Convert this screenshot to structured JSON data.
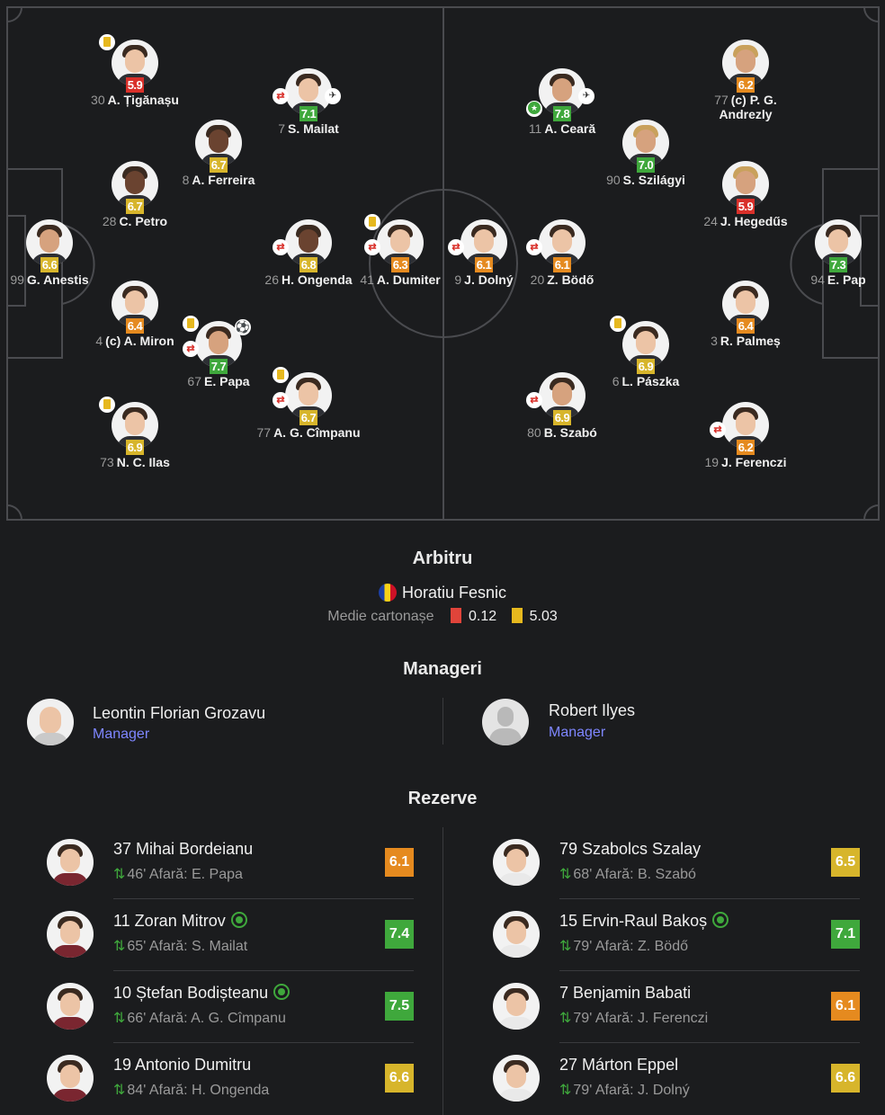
{
  "colors": {
    "red": "#d9302a",
    "orange": "#e58a1f",
    "yellow": "#d7b52b",
    "green": "#3fa83c",
    "link": "#7e86ff"
  },
  "home_players": [
    {
      "num": "30",
      "name": "A. Țigănașu",
      "rating": "5.9",
      "color": "red",
      "icons": [
        "yellow-card"
      ]
    },
    {
      "num": "7",
      "name": "S. Mailat",
      "rating": "7.1",
      "color": "green",
      "icons": [
        "substitution",
        "kit"
      ]
    },
    {
      "num": "8",
      "name": "A. Ferreira",
      "rating": "6.7",
      "color": "yellow",
      "icons": []
    },
    {
      "num": "28",
      "name": "C. Petro",
      "rating": "6.7",
      "color": "yellow",
      "icons": []
    },
    {
      "num": "99",
      "name": "G. Anestis",
      "rating": "6.6",
      "color": "yellow",
      "icons": []
    },
    {
      "num": "26",
      "name": "H. Ongenda",
      "rating": "6.8",
      "color": "yellow",
      "icons": [
        "substitution"
      ]
    },
    {
      "num": "41",
      "name": "A. Dumiter",
      "rating": "6.3",
      "color": "orange",
      "icons": [
        "yellow-card",
        "substitution"
      ]
    },
    {
      "num": "4",
      "name": "(c) A. Miron",
      "rating": "6.4",
      "color": "orange",
      "icons": []
    },
    {
      "num": "67",
      "name": "E. Papa",
      "rating": "7.7",
      "color": "green",
      "icons": [
        "yellow-card",
        "goal",
        "substitution"
      ]
    },
    {
      "num": "77",
      "name": "A. G. Cîmpanu",
      "rating": "6.7",
      "color": "yellow",
      "icons": [
        "yellow-card",
        "substitution"
      ]
    },
    {
      "num": "73",
      "name": "N. C. Ilas",
      "rating": "6.9",
      "color": "yellow",
      "icons": [
        "yellow-card"
      ]
    }
  ],
  "away_players": [
    {
      "num": "11",
      "name": "A. Ceară",
      "rating": "7.8",
      "color": "green",
      "icons": [
        "man-of-match",
        "kit"
      ]
    },
    {
      "num": "77",
      "name": "(c) P. G. Andrezly",
      "rating": "6.2",
      "color": "orange",
      "icons": []
    },
    {
      "num": "90",
      "name": "S. Szilágyi",
      "rating": "7.0",
      "color": "green",
      "icons": []
    },
    {
      "num": "24",
      "name": "J. Hegedűs",
      "rating": "5.9",
      "color": "red",
      "icons": []
    },
    {
      "num": "9",
      "name": "J. Dolný",
      "rating": "6.1",
      "color": "orange",
      "icons": [
        "substitution"
      ]
    },
    {
      "num": "20",
      "name": "Z. Bödő",
      "rating": "6.1",
      "color": "orange",
      "icons": [
        "substitution"
      ]
    },
    {
      "num": "94",
      "name": "E. Pap",
      "rating": "7.3",
      "color": "green",
      "icons": []
    },
    {
      "num": "3",
      "name": "R. Palmeș",
      "rating": "6.4",
      "color": "orange",
      "icons": []
    },
    {
      "num": "6",
      "name": "L. Pászka",
      "rating": "6.9",
      "color": "yellow",
      "icons": [
        "yellow-card"
      ]
    },
    {
      "num": "80",
      "name": "B. Szabó",
      "rating": "6.9",
      "color": "yellow",
      "icons": [
        "substitution"
      ]
    },
    {
      "num": "19",
      "name": "J. Ferenczi",
      "rating": "6.2",
      "color": "orange",
      "icons": [
        "substitution"
      ]
    }
  ],
  "referee": {
    "title": "Arbitru",
    "name": "Horatiu Fesnic",
    "avg_label": "Medie cartonașe",
    "red_avg": "0.12",
    "yellow_avg": "5.03"
  },
  "managers": {
    "title": "Manageri",
    "home": {
      "name": "Leontin Florian Grozavu",
      "role": "Manager"
    },
    "away": {
      "name": "Robert Ilyes",
      "role": "Manager"
    }
  },
  "reserves": {
    "title": "Rezerve",
    "home": [
      {
        "name": "37 Mihai Bordeianu",
        "sub": "46' Afară: E. Papa",
        "rating": "6.1",
        "color": "orange",
        "goal": false
      },
      {
        "name": "11 Zoran Mitrov",
        "sub": "65' Afară: S. Mailat",
        "rating": "7.4",
        "color": "green",
        "goal": true
      },
      {
        "name": "10 Ștefan Bodișteanu",
        "sub": "66' Afară: A. G. Cîmpanu",
        "rating": "7.5",
        "color": "green",
        "goal": true
      },
      {
        "name": "19 Antonio Dumitru",
        "sub": "84' Afară: H. Ongenda",
        "rating": "6.6",
        "color": "yellow",
        "goal": false
      }
    ],
    "away": [
      {
        "name": "79 Szabolcs Szalay",
        "sub": "68' Afară: B. Szabó",
        "rating": "6.5",
        "color": "yellow",
        "goal": false
      },
      {
        "name": "15 Ervin-Raul Bakoș",
        "sub": "79' Afară: Z. Bödő",
        "rating": "7.1",
        "color": "green",
        "goal": true
      },
      {
        "name": "7 Benjamin Babati",
        "sub": "79' Afară: J. Ferenczi",
        "rating": "6.1",
        "color": "orange",
        "goal": false
      },
      {
        "name": "27 Márton Eppel",
        "sub": "79' Afară: J. Dolný",
        "rating": "6.6",
        "color": "yellow",
        "goal": false
      }
    ]
  }
}
